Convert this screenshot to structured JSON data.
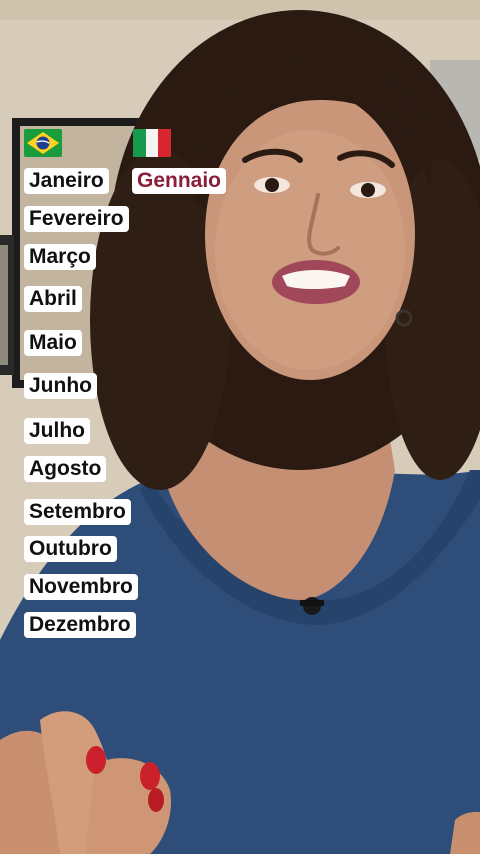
{
  "colors": {
    "background_wall": "#d9cfbe",
    "shirt": "#2e4d78",
    "hair": "#2a1a12",
    "skin": "#c9967a",
    "lips": "#a0485a",
    "italian_word": "#8a1f3a"
  },
  "flags": {
    "left": "brazil-flag-icon",
    "right": "italy-flag-icon"
  },
  "months_pt": [
    "Janeiro",
    "Fevereiro",
    "Março",
    "Abril",
    "Maio",
    "Junho",
    "Julho",
    "Agosto",
    "Setembro",
    "Outubro",
    "Novembro",
    "Dezembro"
  ],
  "months_it": [
    "Gennaio"
  ]
}
